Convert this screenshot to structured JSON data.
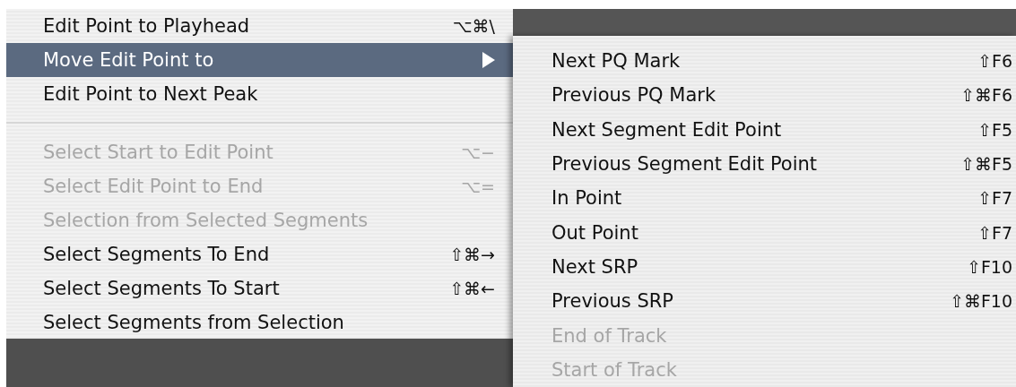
{
  "menu": {
    "items": [
      {
        "kind": "item",
        "label": "Edit Point to Playhead",
        "shortcut": "⌥⌘\\",
        "disabled": false,
        "selected": false,
        "submenu": false
      },
      {
        "kind": "item",
        "label": "Move Edit Point to",
        "disabled": false,
        "selected": true,
        "submenu": true
      },
      {
        "kind": "item",
        "label": "Edit Point to Next Peak",
        "disabled": false,
        "selected": false,
        "submenu": false
      },
      {
        "kind": "separator"
      },
      {
        "kind": "item",
        "label": "Select Start to Edit Point",
        "shortcut": "⌥−",
        "disabled": true,
        "selected": false,
        "submenu": false
      },
      {
        "kind": "item",
        "label": "Select Edit Point to End",
        "shortcut": "⌥=",
        "disabled": true,
        "selected": false,
        "submenu": false
      },
      {
        "kind": "item",
        "label": "Selection from Selected Segments",
        "disabled": true,
        "selected": false,
        "submenu": false
      },
      {
        "kind": "item",
        "label": "Select Segments To End",
        "shortcut": "⇧⌘→",
        "disabled": false,
        "selected": false,
        "submenu": false
      },
      {
        "kind": "item",
        "label": "Select Segments To Start",
        "shortcut": "⇧⌘←",
        "disabled": false,
        "selected": false,
        "submenu": false
      },
      {
        "kind": "item",
        "label": "Select Segments from Selection",
        "disabled": false,
        "selected": false,
        "submenu": false
      }
    ]
  },
  "submenu": {
    "items": [
      {
        "label": "Next PQ Mark",
        "shortcut": "⇧F6",
        "disabled": false
      },
      {
        "label": "Previous PQ Mark",
        "shortcut": "⇧⌘F6",
        "disabled": false
      },
      {
        "label": "Next Segment Edit Point",
        "shortcut": "⇧F5",
        "disabled": false
      },
      {
        "label": "Previous Segment Edit Point",
        "shortcut": "⇧⌘F5",
        "disabled": false
      },
      {
        "label": "In Point",
        "shortcut": "⇧F7",
        "disabled": false
      },
      {
        "label": "Out Point",
        "shortcut": "⇧F7",
        "disabled": false
      },
      {
        "label": "Next SRP",
        "shortcut": "⇧F10",
        "disabled": false
      },
      {
        "label": "Previous SRP",
        "shortcut": "⇧⌘F10",
        "disabled": false
      },
      {
        "label": "End of Track",
        "disabled": true
      },
      {
        "label": "Start of Track",
        "disabled": true
      }
    ]
  }
}
